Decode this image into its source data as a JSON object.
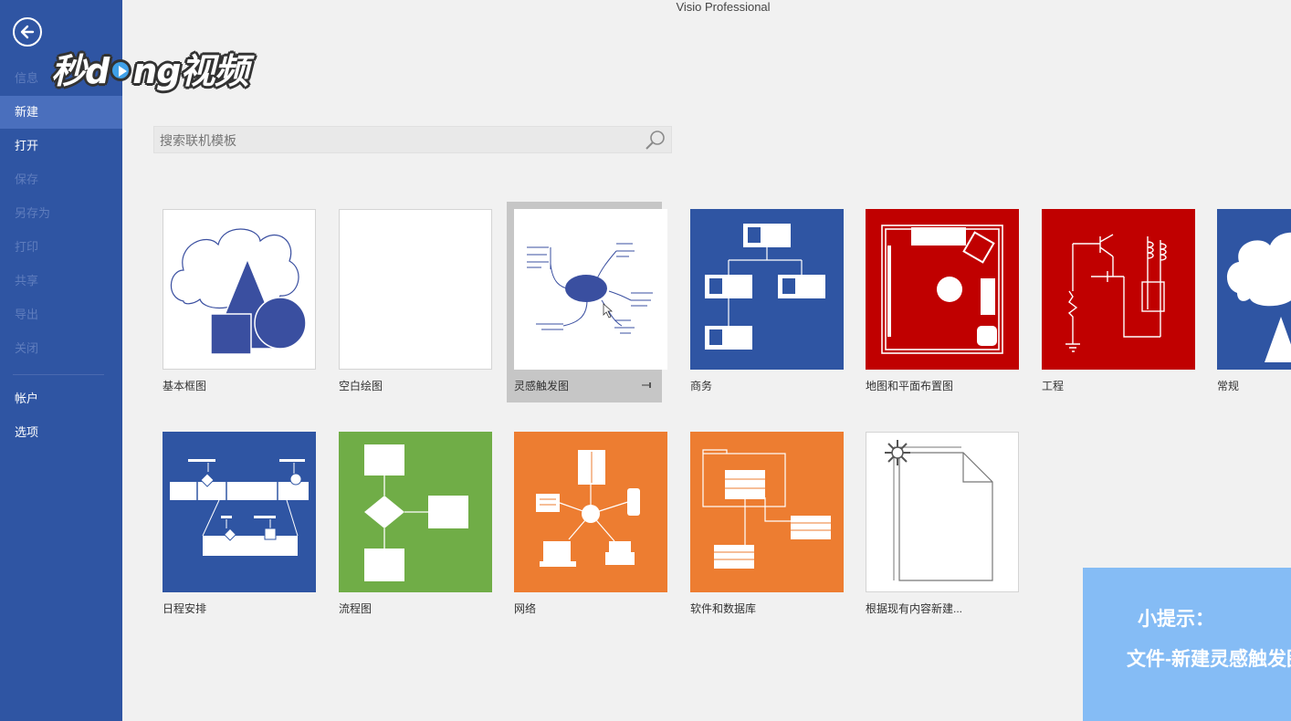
{
  "app": {
    "title": "Visio Professional"
  },
  "watermark": {
    "logo_text": "秒dong视频"
  },
  "sidebar": {
    "items": [
      {
        "label": "信息",
        "state": "disabled"
      },
      {
        "label": "新建",
        "state": "active"
      },
      {
        "label": "打开",
        "state": "normal"
      },
      {
        "label": "保存",
        "state": "disabled"
      },
      {
        "label": "另存为",
        "state": "disabled"
      },
      {
        "label": "打印",
        "state": "disabled"
      },
      {
        "label": "共享",
        "state": "disabled"
      },
      {
        "label": "导出",
        "state": "disabled"
      },
      {
        "label": "关闭",
        "state": "disabled"
      },
      {
        "label": "帐户",
        "state": "normal"
      },
      {
        "label": "选项",
        "state": "normal"
      }
    ]
  },
  "search": {
    "placeholder": "搜索联机模板"
  },
  "templates": [
    {
      "label": "基本框图",
      "bg": "#ffffff",
      "icon": "basic-shapes-icon"
    },
    {
      "label": "空白绘图",
      "bg": "#ffffff",
      "icon": "blank-page-icon"
    },
    {
      "label": "灵感触发图",
      "bg": "#ffffff",
      "icon": "brainstorm-icon",
      "selected": true
    },
    {
      "label": "商务",
      "bg": "#2f55a3",
      "icon": "org-chart-icon"
    },
    {
      "label": "地图和平面布置图",
      "bg": "#c00000",
      "icon": "floor-plan-icon"
    },
    {
      "label": "工程",
      "bg": "#c00000",
      "icon": "circuit-icon"
    },
    {
      "label": "常规",
      "bg": "#2f55a3",
      "icon": "general-shapes-icon"
    },
    {
      "label": "日程安排",
      "bg": "#2f55a3",
      "icon": "timeline-icon"
    },
    {
      "label": "流程图",
      "bg": "#70ad47",
      "icon": "flowchart-icon"
    },
    {
      "label": "网络",
      "bg": "#ed7d31",
      "icon": "network-icon"
    },
    {
      "label": "软件和数据库",
      "bg": "#ed7d31",
      "icon": "database-icon"
    },
    {
      "label": "根据现有内容新建...",
      "bg": "#ffffff",
      "icon": "new-from-existing-icon"
    }
  ],
  "tip": {
    "title": "小提示：",
    "body": "文件-新建灵感触发图"
  },
  "colors": {
    "sidebar": "#2f55a3",
    "accent_blue": "#2f55a3",
    "red": "#c00000",
    "green": "#70ad47",
    "orange": "#ed7d31",
    "tip_bg": "#85bcf5"
  }
}
